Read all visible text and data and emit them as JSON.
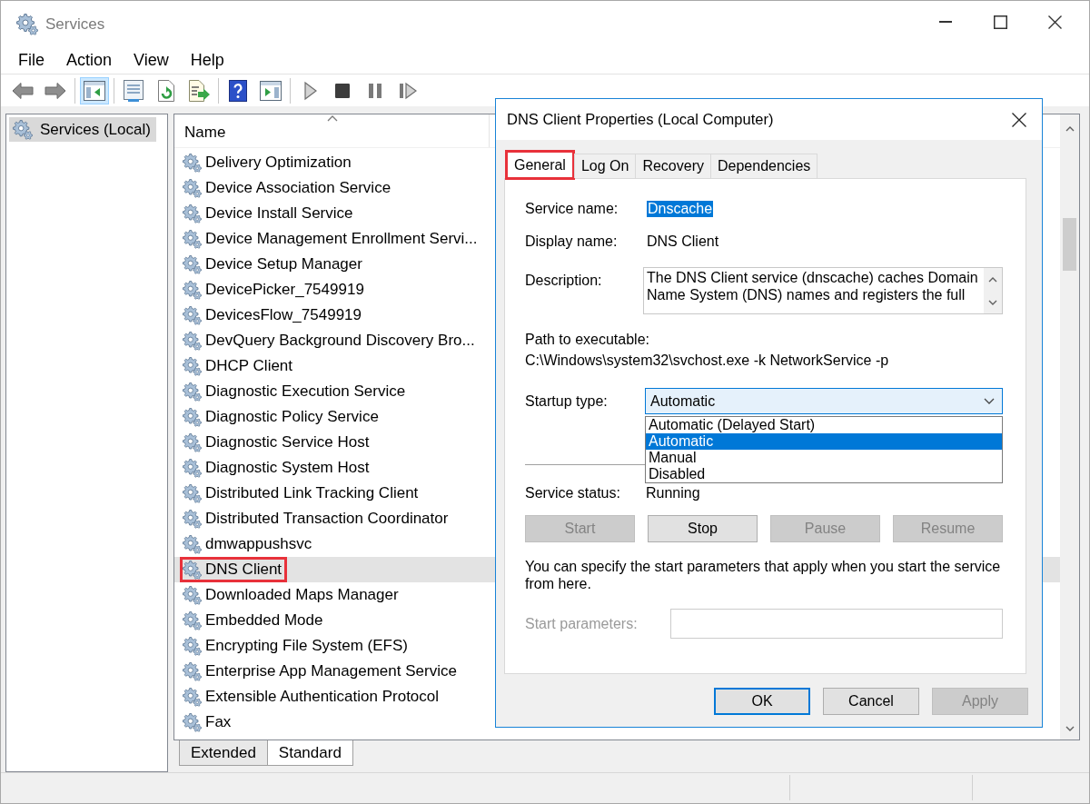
{
  "window": {
    "title": "Services"
  },
  "menu": [
    "File",
    "Action",
    "View",
    "Help"
  ],
  "toolbar": [
    [
      {
        "kind": "back",
        "pressed": false
      },
      {
        "kind": "forward",
        "pressed": false
      }
    ],
    [
      {
        "kind": "console_tree",
        "pressed": true
      }
    ],
    [
      {
        "kind": "properties",
        "pressed": false
      },
      {
        "kind": "refresh",
        "pressed": false
      },
      {
        "kind": "export",
        "pressed": false
      }
    ],
    [
      {
        "kind": "help",
        "pressed": false
      },
      {
        "kind": "action_pane",
        "pressed": false
      }
    ],
    [
      {
        "kind": "play",
        "pressed": false
      },
      {
        "kind": "stop",
        "pressed": false
      },
      {
        "kind": "pause",
        "pressed": false
      },
      {
        "kind": "resume",
        "pressed": false
      }
    ]
  ],
  "tree": [
    {
      "label": "Services (Local)",
      "selected": true
    }
  ],
  "list": {
    "columns": [
      {
        "label": "Name",
        "sorted_ascending": true
      }
    ],
    "rows": [
      {
        "name": "Delivery Optimization",
        "selected": false,
        "highlighted": false
      },
      {
        "name": "Device Association Service",
        "selected": false,
        "highlighted": false
      },
      {
        "name": "Device Install Service",
        "selected": false,
        "highlighted": false
      },
      {
        "name": "Device Management Enrollment Servi...",
        "selected": false,
        "highlighted": false
      },
      {
        "name": "Device Setup Manager",
        "selected": false,
        "highlighted": false
      },
      {
        "name": "DevicePicker_7549919",
        "selected": false,
        "highlighted": false
      },
      {
        "name": "DevicesFlow_7549919",
        "selected": false,
        "highlighted": false
      },
      {
        "name": "DevQuery Background Discovery Bro...",
        "selected": false,
        "highlighted": false
      },
      {
        "name": "DHCP Client",
        "selected": false,
        "highlighted": false
      },
      {
        "name": "Diagnostic Execution Service",
        "selected": false,
        "highlighted": false
      },
      {
        "name": "Diagnostic Policy Service",
        "selected": false,
        "highlighted": false
      },
      {
        "name": "Diagnostic Service Host",
        "selected": false,
        "highlighted": false
      },
      {
        "name": "Diagnostic System Host",
        "selected": false,
        "highlighted": false
      },
      {
        "name": "Distributed Link Tracking Client",
        "selected": false,
        "highlighted": false
      },
      {
        "name": "Distributed Transaction Coordinator",
        "selected": false,
        "highlighted": false
      },
      {
        "name": "dmwappushsvc",
        "selected": false,
        "highlighted": false
      },
      {
        "name": "DNS Client",
        "selected": true,
        "highlighted": true
      },
      {
        "name": "Downloaded Maps Manager",
        "selected": false,
        "highlighted": false
      },
      {
        "name": "Embedded Mode",
        "selected": false,
        "highlighted": false
      },
      {
        "name": "Encrypting File System (EFS)",
        "selected": false,
        "highlighted": false
      },
      {
        "name": "Enterprise App Management Service",
        "selected": false,
        "highlighted": false
      },
      {
        "name": "Extensible Authentication Protocol",
        "selected": false,
        "highlighted": false
      },
      {
        "name": "Fax",
        "selected": false,
        "highlighted": false
      }
    ]
  },
  "view_tabs": [
    {
      "label": "Extended",
      "selected": false
    },
    {
      "label": "Standard",
      "selected": true
    }
  ],
  "dialog": {
    "title": "DNS Client Properties (Local Computer)",
    "tabs": [
      {
        "label": "General",
        "selected": true,
        "highlighted": true
      },
      {
        "label": "Log On",
        "selected": false,
        "highlighted": false
      },
      {
        "label": "Recovery",
        "selected": false,
        "highlighted": false
      },
      {
        "label": "Dependencies",
        "selected": false,
        "highlighted": false
      }
    ],
    "service_name": {
      "label": "Service name:",
      "value": "Dnscache",
      "value_selected": true
    },
    "display_name": {
      "label": "Display name:",
      "value": "DNS Client"
    },
    "description": {
      "label": "Description:",
      "value": "The DNS Client service (dnscache) caches Domain Name System (DNS) names and registers the full"
    },
    "path": {
      "label": "Path to executable:",
      "value": "C:\\Windows\\system32\\svchost.exe -k NetworkService -p"
    },
    "startup_type": {
      "label": "Startup type:",
      "value": "Automatic",
      "expanded": true,
      "options": [
        {
          "label": "Automatic (Delayed Start)",
          "selected": false
        },
        {
          "label": "Automatic",
          "selected": true
        },
        {
          "label": "Manual",
          "selected": false
        },
        {
          "label": "Disabled",
          "selected": false
        }
      ]
    },
    "status": {
      "label": "Service status:",
      "value": "Running"
    },
    "service_buttons": [
      {
        "label": "Start",
        "disabled": true
      },
      {
        "label": "Stop",
        "disabled": false
      },
      {
        "label": "Pause",
        "disabled": true
      },
      {
        "label": "Resume",
        "disabled": true
      }
    ],
    "note": "You can specify the start parameters that apply when you start the service from here.",
    "start_parameters": {
      "label": "Start parameters:",
      "disabled": true
    },
    "buttons": [
      {
        "label": "OK",
        "default": true,
        "disabled": false
      },
      {
        "label": "Cancel",
        "default": false,
        "disabled": false
      },
      {
        "label": "Apply",
        "default": false,
        "disabled": true
      }
    ]
  }
}
